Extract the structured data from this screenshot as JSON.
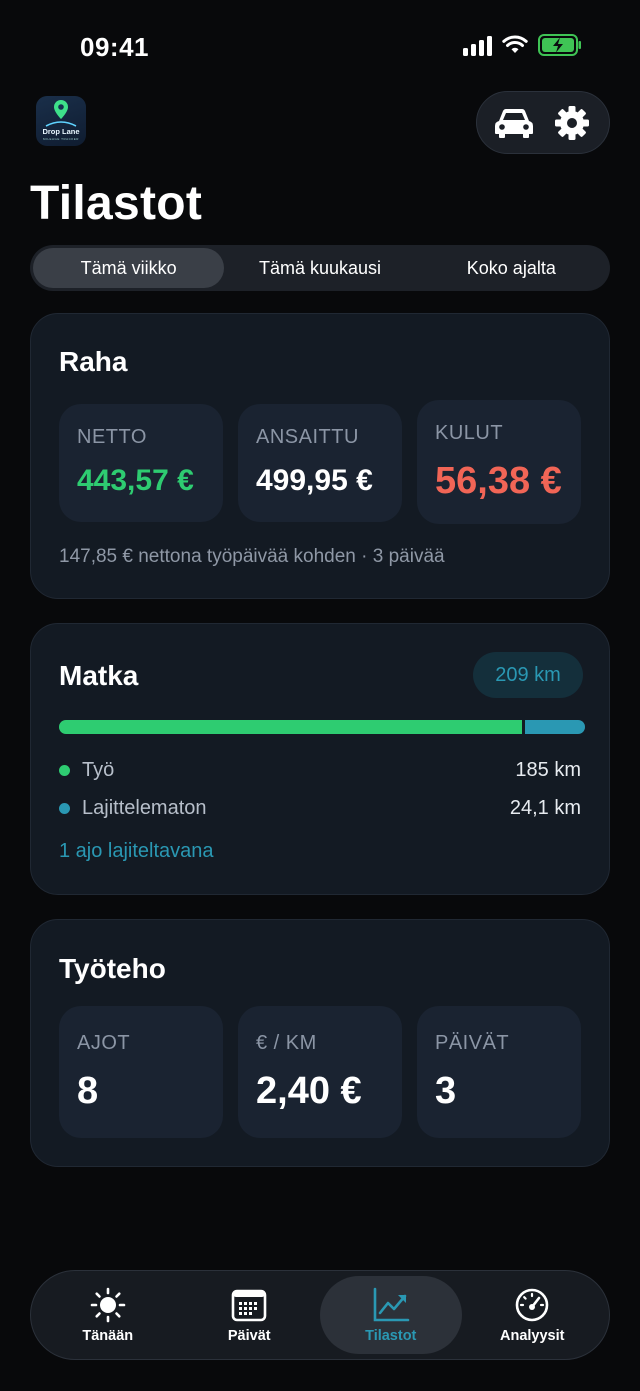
{
  "status_bar": {
    "time": "09:41"
  },
  "app": {
    "logo_name": "Drop Lane",
    "logo_subtitle": "MILEAGE TRACKER"
  },
  "page": {
    "title": "Tilastot"
  },
  "segments": [
    {
      "label": "Tämä viikko",
      "active": true
    },
    {
      "label": "Tämä kuukausi",
      "active": false
    },
    {
      "label": "Koko ajalta",
      "active": false
    }
  ],
  "money": {
    "title": "Raha",
    "tiles": [
      {
        "label": "NETTO",
        "value": "443,57 €",
        "color": "#2ecc71"
      },
      {
        "label": "ANSAITTU",
        "value": "499,95 €",
        "color": "#ffffff"
      },
      {
        "label": "KULUT",
        "value": "56,38 €",
        "color": "#f16556"
      }
    ],
    "caption": "147,85 € nettona työpäivää kohden · 3 päivää"
  },
  "trip": {
    "title": "Matka",
    "total": "209 km",
    "bar_fractions": {
      "work": 0.885,
      "uncategorized": 0.115
    },
    "legend": [
      {
        "label": "Työ",
        "value": "185 km",
        "color": "#2ecc71"
      },
      {
        "label": "Lajittelematon",
        "value": "24,1 km",
        "color": "#2a98b3"
      }
    ],
    "link": "1 ajo lajiteltavana"
  },
  "efficiency": {
    "title": "Työteho",
    "tiles": [
      {
        "label": "AJOT",
        "value": "8"
      },
      {
        "label": "€ / KM",
        "value": "2,40 €"
      },
      {
        "label": "PÄIVÄT",
        "value": "3"
      }
    ]
  },
  "tabs": [
    {
      "label": "Tänään",
      "icon": "sun-icon",
      "active": false
    },
    {
      "label": "Päivät",
      "icon": "calendar-icon",
      "active": false
    },
    {
      "label": "Tilastot",
      "icon": "chart-icon",
      "active": true
    },
    {
      "label": "Analyysit",
      "icon": "gauge-icon",
      "active": false
    }
  ],
  "colors": {
    "accent": "#2a98b3",
    "positive": "#2ecc71",
    "negative": "#f16556",
    "background": "#08090b"
  }
}
